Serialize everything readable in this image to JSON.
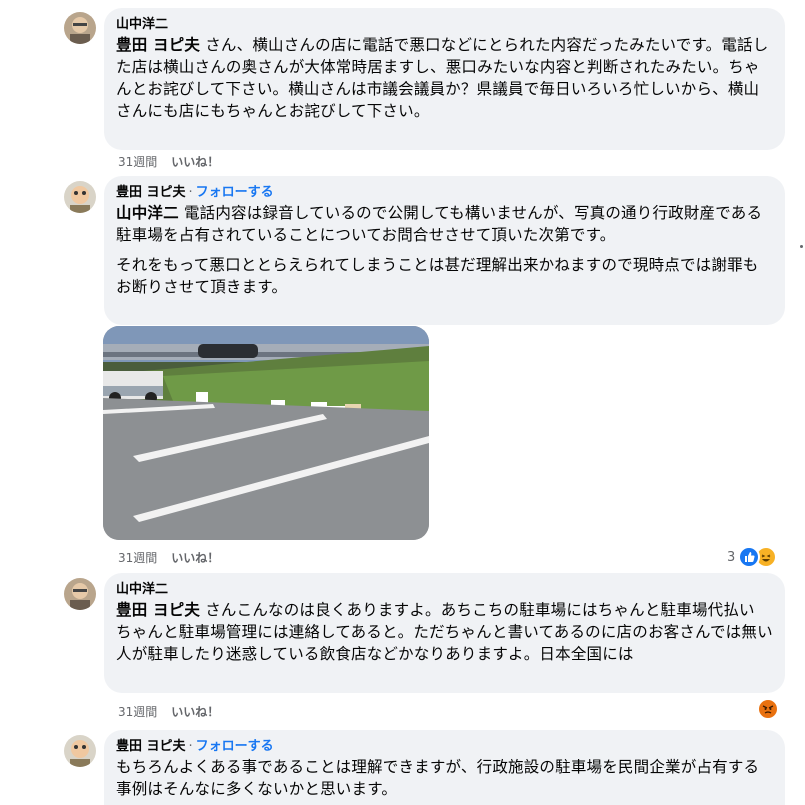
{
  "comments": [
    {
      "author": "山中洋二",
      "mention": "豊田 ヨピ夫",
      "text": " さん、横山さんの店に電話で悪口などにとられた内容だったみたいです。電話した店は横山さんの奥さんが大体常時居ますし、悪口みたいな内容と判断されたみたい。ちゃんとお詫びして下さい。横山さんは市議会議員か？県議員で毎日いろいろ忙しいから、横山さんにも店にもちゃんとお詫びして下さい。",
      "time": "31週間",
      "like": "いいね！"
    },
    {
      "author": "豊田 ヨピ夫",
      "follow": "フォローする",
      "mention": "山中洋二",
      "text": " 電話内容は録音しているので公開しても構いませんが、写真の通り行政財産である駐車場を占有されていることについてお問合せさせて頂いた次第です。",
      "text2": "それをもって悪口ととらえられてしまうことは甚だ理解出来かねますので現時点では謝罪もお断りさせて頂きます。",
      "time": "31週間",
      "like": "いいね！",
      "reaction_count": "3"
    },
    {
      "author": "山中洋二",
      "mention": "豊田 ヨピ夫",
      "text": " さんこんなのは良くありますよ。あちこちの駐車場にはちゃんと駐車場代払い　ちゃんと駐車場管理には連絡してあると。ただちゃんと書いてあるのに店のお客さんでは無い人が駐車したり迷惑している飲食店などかなりありますよ。日本全国には",
      "time": "31週間",
      "like": "いいね！"
    },
    {
      "author": "豊田 ヨピ夫",
      "follow": "フォローする",
      "text": "もちろんよくある事であることは理解できますが、行政施設の駐車場を民間企業が占有する事例はそんなに多くないかと思います。"
    }
  ],
  "colors": {
    "bubble": "#f0f2f5",
    "link": "#1877f2",
    "meta": "#65676b",
    "like_reaction": "#1877f2",
    "haha_reaction": "#f7b125",
    "angry_reaction": "#e9710f"
  },
  "icons": [
    "like-reaction-icon",
    "haha-reaction-icon",
    "angry-reaction-icon"
  ]
}
